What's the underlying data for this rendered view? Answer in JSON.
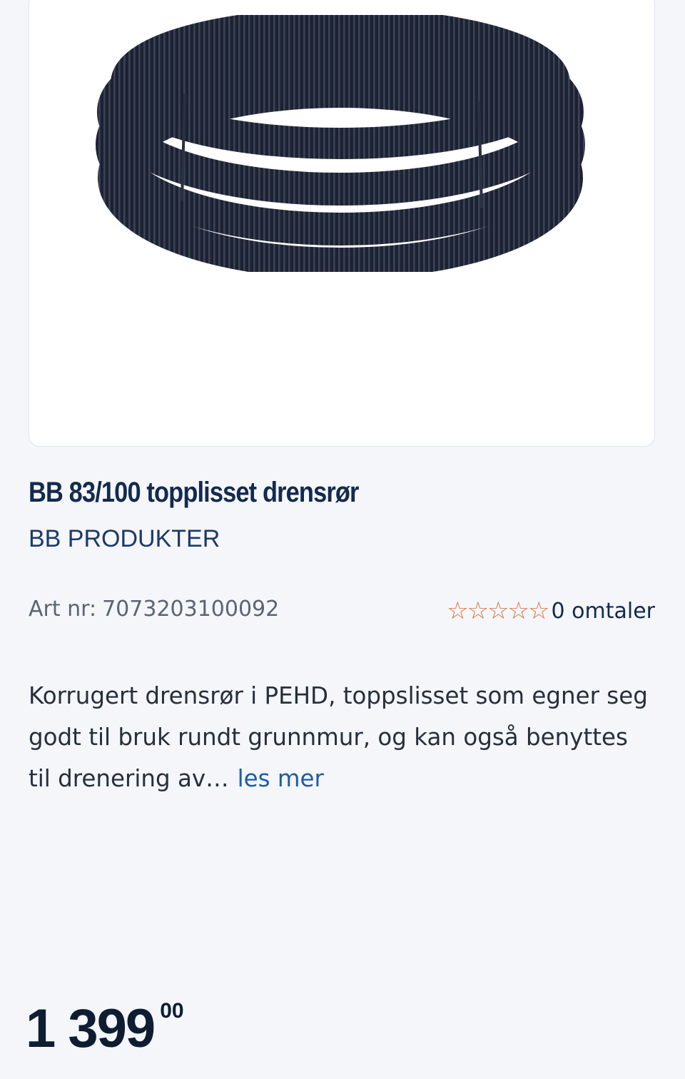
{
  "product": {
    "image_icon": "corrugated-drain-pipe-coil",
    "title": "BB 83/100 topplisset drensrør",
    "brand": "BB PRODUKTER",
    "article_label": "Art nr:",
    "article_number": "7073203100092",
    "rating": {
      "stars_filled": 0,
      "stars_total": 5,
      "reviews_text": "0 omtaler",
      "star_color": "#d9743c"
    },
    "description": "Korrugert drensrør i PEHD, toppslisset som egner seg godt til bruk rundt grunnmur, og kan også benyttes til drenering av…",
    "read_more": "les mer",
    "price": {
      "major": "1 399",
      "minor": "00"
    }
  },
  "colors": {
    "background": "#f4f6fa",
    "title": "#142a4d",
    "link": "#1d5da8"
  }
}
